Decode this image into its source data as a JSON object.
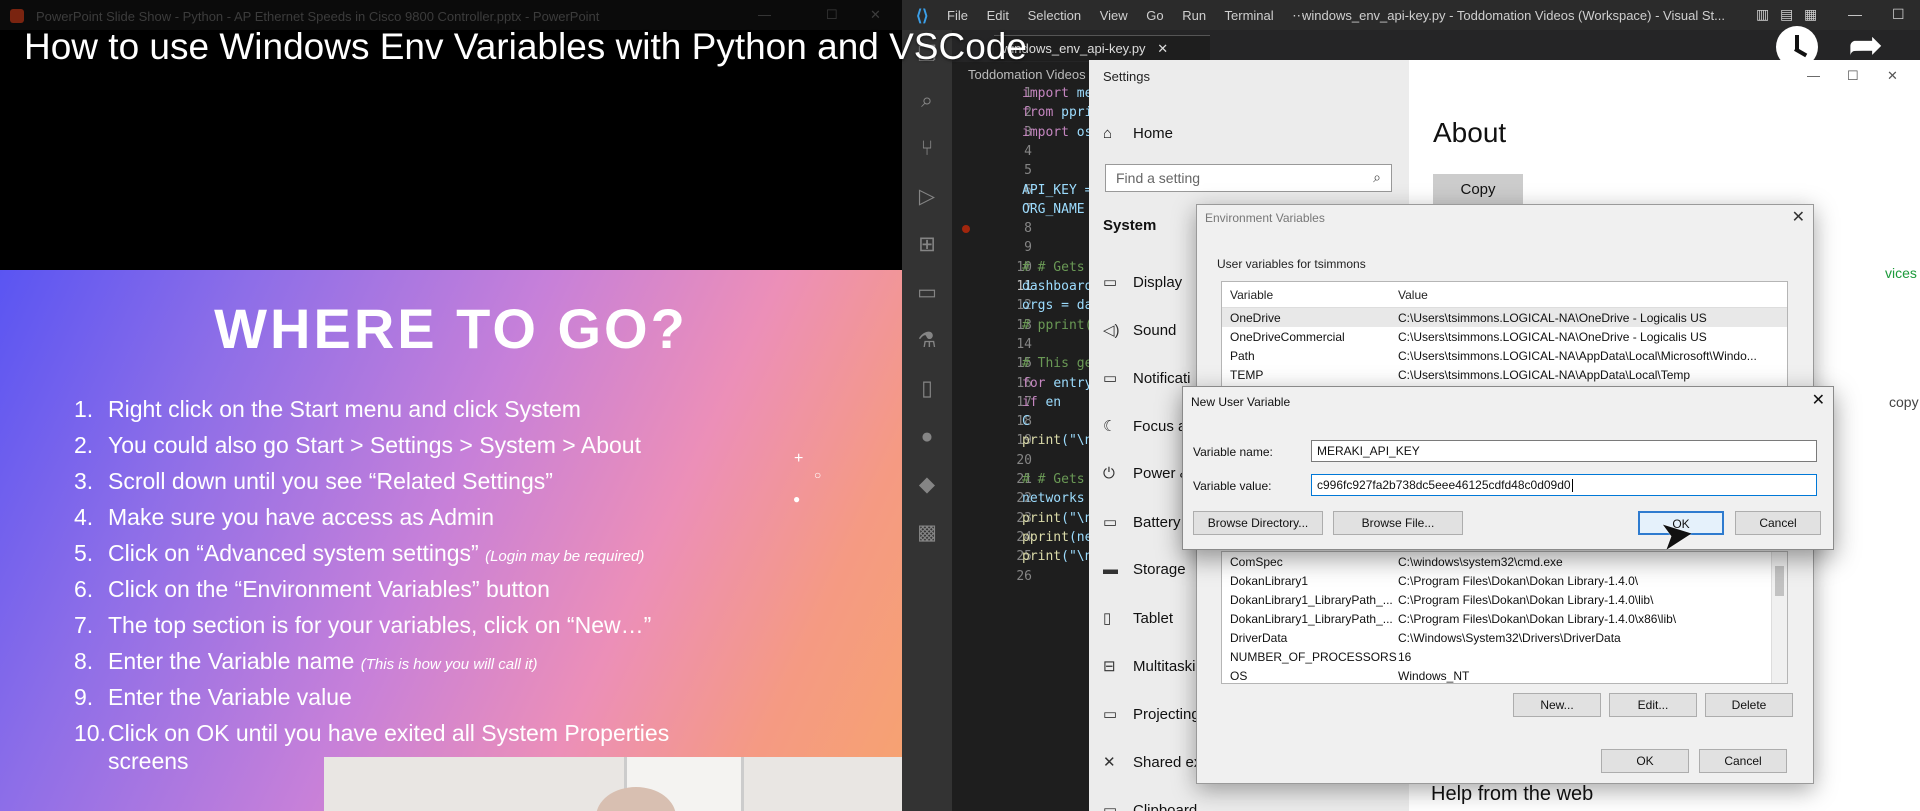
{
  "video": {
    "title": "How to use Windows Env Variables with Python and VSCode"
  },
  "powerpoint": {
    "window_title": "PowerPoint Slide Show  -  Python - AP Ethernet Speeds in Cisco 9800 Controller.pptx  -  PowerPoint",
    "slide": {
      "heading": "WHERE TO GO?",
      "steps": [
        {
          "num": "1.",
          "text": "Right click on the Start menu and click System",
          "note": ""
        },
        {
          "num": "2.",
          "text": "You could also go Start > Settings > System > About",
          "note": ""
        },
        {
          "num": "3.",
          "text": "Scroll down until you see “Related Settings”",
          "note": ""
        },
        {
          "num": "4.",
          "text": "Make sure you have access as Admin",
          "note": ""
        },
        {
          "num": "5.",
          "text": "Click on “Advanced system settings” ",
          "note": "(Login may be required)"
        },
        {
          "num": "6.",
          "text": "Click on the “Environment Variables” button",
          "note": ""
        },
        {
          "num": "7.",
          "text": "The top section is for your variables, click on “New…”",
          "note": ""
        },
        {
          "num": "8.",
          "text": "Enter the Variable name ",
          "note": "(This is how you will call it)"
        },
        {
          "num": "9.",
          "text": "Enter the Variable value",
          "note": ""
        },
        {
          "num": "10.",
          "text": "Click on OK until you have exited all System Properties",
          "note": ""
        },
        {
          "num": "",
          "text": "screens",
          "note": ""
        }
      ]
    }
  },
  "vscode": {
    "menu": [
      "File",
      "Edit",
      "Selection",
      "View",
      "Go",
      "Run",
      "Terminal",
      "⋯"
    ],
    "window_title": "windows_env_api-key.py - Toddomation Videos (Workspace) - Visual St...",
    "tab_label": "windows_env_api-key.py",
    "breadcrumb": "Toddomation Videos",
    "line_numbers": [
      "1",
      "2",
      "3",
      "4",
      "5",
      "6",
      "7",
      "8",
      "9",
      "10",
      "11",
      "12",
      "13",
      "14",
      "15",
      "16",
      "17",
      "18",
      "19",
      "20",
      "21",
      "22",
      "23",
      "24",
      "25",
      "26"
    ],
    "current_line": "11",
    "code_lines": [
      [
        {
          "t": "import ",
          "c": "kw"
        },
        {
          "t": "me",
          "c": "var"
        }
      ],
      [
        {
          "t": "from ",
          "c": "kw"
        },
        {
          "t": "ppri",
          "c": "var"
        }
      ],
      [
        {
          "t": "import ",
          "c": "kw"
        },
        {
          "t": "os",
          "c": "var"
        }
      ],
      [],
      [],
      [
        {
          "t": "API_KEY =",
          "c": "var"
        }
      ],
      [
        {
          "t": "ORG_NAME",
          "c": "var"
        }
      ],
      [],
      [],
      [
        {
          "t": "# # Gets",
          "c": "cmt"
        }
      ],
      [
        {
          "t": "dashboard",
          "c": "var"
        }
      ],
      [
        {
          "t": "orgs = da",
          "c": "var"
        }
      ],
      [
        {
          "t": "# pprint(",
          "c": "cmt"
        }
      ],
      [],
      [
        {
          "t": "# This ge",
          "c": "cmt"
        }
      ],
      [
        {
          "t": "for ",
          "c": "kw"
        },
        {
          "t": "entry",
          "c": "var"
        }
      ],
      [
        {
          "t": "    if ",
          "c": "kw"
        },
        {
          "t": "en",
          "c": "var"
        }
      ],
      [
        {
          "t": "        ",
          "c": "var"
        },
        {
          "t": "C",
          "c": "var"
        }
      ],
      [
        {
          "t": "print",
          "c": "fn"
        },
        {
          "t": "(\"\\n",
          "c": "var"
        }
      ],
      [],
      [
        {
          "t": "# # Gets",
          "c": "cmt"
        }
      ],
      [
        {
          "t": "networks",
          "c": "var"
        }
      ],
      [
        {
          "t": "print",
          "c": "fn"
        },
        {
          "t": "(\"\\n",
          "c": "var"
        }
      ],
      [
        {
          "t": "pprint",
          "c": "fn"
        },
        {
          "t": "(ne",
          "c": "var"
        }
      ],
      [
        {
          "t": "print",
          "c": "fn"
        },
        {
          "t": "(\"\\n",
          "c": "var"
        }
      ],
      []
    ]
  },
  "settings": {
    "window_title": "Settings",
    "home": "Home",
    "search_placeholder": "Find a setting",
    "section": "System",
    "nav": [
      "Display",
      "Sound",
      "Notificati",
      "Focus a",
      "Power &",
      "Battery",
      "Storage",
      "Tablet",
      "Multitaski",
      "Projecting",
      "Shared ex",
      "Clipboard"
    ],
    "main": {
      "heading": "About",
      "copy_button": "Copy",
      "fragment_services": "vices",
      "fragment_copy": "copy",
      "help": "Help from the web"
    }
  },
  "env_dialog": {
    "title": "Environment Variables",
    "user_group": "User variables for tsimmons",
    "columns": [
      "Variable",
      "Value"
    ],
    "user_vars": [
      {
        "name": "OneDrive",
        "value": "C:\\Users\\tsimmons.LOGICAL-NA\\OneDrive - Logicalis US"
      },
      {
        "name": "OneDriveCommercial",
        "value": "C:\\Users\\tsimmons.LOGICAL-NA\\OneDrive - Logicalis US"
      },
      {
        "name": "Path",
        "value": "C:\\Users\\tsimmons.LOGICAL-NA\\AppData\\Local\\Microsoft\\Windo..."
      },
      {
        "name": "TEMP",
        "value": "C:\\Users\\tsimmons.LOGICAL-NA\\AppData\\Local\\Temp"
      }
    ],
    "system_vars": [
      {
        "name": "ComSpec",
        "value": "C:\\windows\\system32\\cmd.exe"
      },
      {
        "name": "DokanLibrary1",
        "value": "C:\\Program Files\\Dokan\\Dokan Library-1.4.0\\"
      },
      {
        "name": "DokanLibrary1_LibraryPath_...",
        "value": "C:\\Program Files\\Dokan\\Dokan Library-1.4.0\\lib\\"
      },
      {
        "name": "DokanLibrary1_LibraryPath_...",
        "value": "C:\\Program Files\\Dokan\\Dokan Library-1.4.0\\x86\\lib\\"
      },
      {
        "name": "DriverData",
        "value": "C:\\Windows\\System32\\Drivers\\DriverData"
      },
      {
        "name": "NUMBER_OF_PROCESSORS",
        "value": "16"
      },
      {
        "name": "OS",
        "value": "Windows_NT"
      }
    ],
    "buttons": {
      "new": "New...",
      "edit": "Edit...",
      "delete": "Delete",
      "ok": "OK",
      "cancel": "Cancel"
    }
  },
  "new_var_dialog": {
    "title": "New User Variable",
    "name_label": "Variable name:",
    "name_value": "MERAKI_API_KEY",
    "value_label": "Variable value:",
    "value_value": "c996fc927fa2b738dc5eee46125cdfd48c0d09d0",
    "buttons": {
      "browse_dir": "Browse Directory...",
      "browse_file": "Browse File...",
      "ok": "OK",
      "cancel": "Cancel"
    }
  }
}
